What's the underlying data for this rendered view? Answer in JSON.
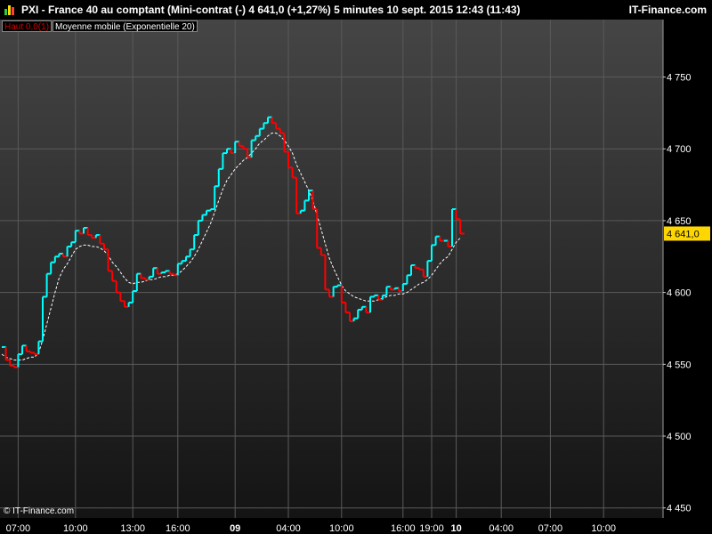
{
  "header": {
    "title": "PXI - France 40 au comptant (Mini-contrat  (-)    4 641,0 (+1,27%)     5 minutes  10 sept. 2015 12:43 (11:43)",
    "brand": "IT-Finance.com",
    "colors": {
      "up": "#00ffff",
      "down": "#ff0000",
      "ema": "#ffffff"
    }
  },
  "legend": {
    "item1": "Haut 0,0(1)",
    "item2": "Moyenne mobile (Exponentielle 20)"
  },
  "footer": {
    "copyright": "© IT-Finance.com"
  },
  "chart_data": {
    "type": "line",
    "series": [
      {
        "name": "",
        "style": "step",
        "color_up": "#00ffff",
        "color_down": "#ff0000",
        "values": [
          4562,
          4553,
          4549,
          4548,
          4557,
          4563,
          4559,
          4558,
          4557,
          4566,
          4597,
          4613,
          4621,
          4625,
          4627,
          4625,
          4632,
          4635,
          4643,
          4641,
          4645,
          4640,
          4638,
          4640,
          4634,
          4630,
          4615,
          4608,
          4600,
          4594,
          4590,
          4593,
          4601,
          4613,
          4610,
          4609,
          4611,
          4617,
          4613,
          4614,
          4615,
          4613,
          4612,
          4620,
          4622,
          4625,
          4630,
          4640,
          4650,
          4654,
          4657,
          4658,
          4674,
          4686,
          4697,
          4700,
          4697,
          4705,
          4702,
          4700,
          4694,
          4706,
          4709,
          4714,
          4718,
          4722,
          4718,
          4714,
          4711,
          4698,
          4687,
          4680,
          4655,
          4657,
          4664,
          4671,
          4658,
          4631,
          4626,
          4602,
          4597,
          4604,
          4605,
          4593,
          4586,
          4580,
          4582,
          4588,
          4590,
          4586,
          4597,
          4598,
          4595,
          4598,
          4604,
          4602,
          4603,
          4601,
          4606,
          4612,
          4619,
          4617,
          4616,
          4611,
          4622,
          4633,
          4639,
          4636,
          4636,
          4632,
          4658,
          4651,
          4641
        ]
      },
      {
        "name": "Moyenne mobile (Exponentielle 20)",
        "style": "dashed",
        "color": "#ffffff",
        "values": [
          4557,
          4555,
          4554,
          4553,
          4553,
          4553,
          4554,
          4555,
          4555,
          4558,
          4567,
          4578,
          4589,
          4600,
          4610,
          4616,
          4620,
          4625,
          4630,
          4632,
          4633,
          4633,
          4632,
          4632,
          4631,
          4629,
          4626,
          4621,
          4618,
          4614,
          4610,
          4607,
          4606,
          4607,
          4607,
          4608,
          4609,
          4609,
          4610,
          4611,
          4611,
          4612,
          4612,
          4613,
          4615,
          4618,
          4621,
          4625,
          4630,
          4636,
          4642,
          4648,
          4656,
          4664,
          4672,
          4678,
          4682,
          4686,
          4689,
          4692,
          4694,
          4697,
          4700,
          4704,
          4706,
          4709,
          4711,
          4711,
          4709,
          4706,
          4702,
          4697,
          4689,
          4683,
          4677,
          4671,
          4664,
          4654,
          4644,
          4634,
          4624,
          4617,
          4611,
          4605,
          4601,
          4599,
          4597,
          4596,
          4595,
          4594,
          4594,
          4594,
          4595,
          4596,
          4597,
          4598,
          4598,
          4599,
          4599,
          4600,
          4602,
          4604,
          4606,
          4607,
          4609,
          4612,
          4616,
          4620,
          4623,
          4625,
          4630,
          4635,
          4638
        ]
      }
    ],
    "price_label": "4 641,0",
    "yticks": [
      {
        "v": 4450,
        "label": "4 450"
      },
      {
        "v": 4500,
        "label": "4 500"
      },
      {
        "v": 4550,
        "label": "4 550"
      },
      {
        "v": 4600,
        "label": "4 600"
      },
      {
        "v": 4650,
        "label": "4 650"
      },
      {
        "v": 4700,
        "label": "4 700"
      },
      {
        "v": 4750,
        "label": "4 750"
      }
    ],
    "ylim": [
      4443,
      4790
    ],
    "xticks": [
      {
        "i": 4,
        "label": "07:00",
        "bold": false
      },
      {
        "i": 18,
        "label": "10:00",
        "bold": false
      },
      {
        "i": 32,
        "label": "13:00",
        "bold": false
      },
      {
        "i": 43,
        "label": "16:00",
        "bold": false
      },
      {
        "i": 57,
        "label": "09",
        "bold": true
      },
      {
        "i": 70,
        "label": "04:00",
        "bold": false
      },
      {
        "i": 83,
        "label": "10:00",
        "bold": false
      },
      {
        "i": 98,
        "label": "16:00",
        "bold": false
      },
      {
        "i": 105,
        "label": "19:00",
        "bold": false
      },
      {
        "i": 111,
        "label": "10",
        "bold": true
      },
      {
        "i": 122,
        "label": "04:00",
        "bold": false
      },
      {
        "i": 134,
        "label": "07:00",
        "bold": false
      },
      {
        "i": 147,
        "label": "10:00",
        "bold": false
      }
    ],
    "grid": true,
    "legend_position": "top-left"
  }
}
